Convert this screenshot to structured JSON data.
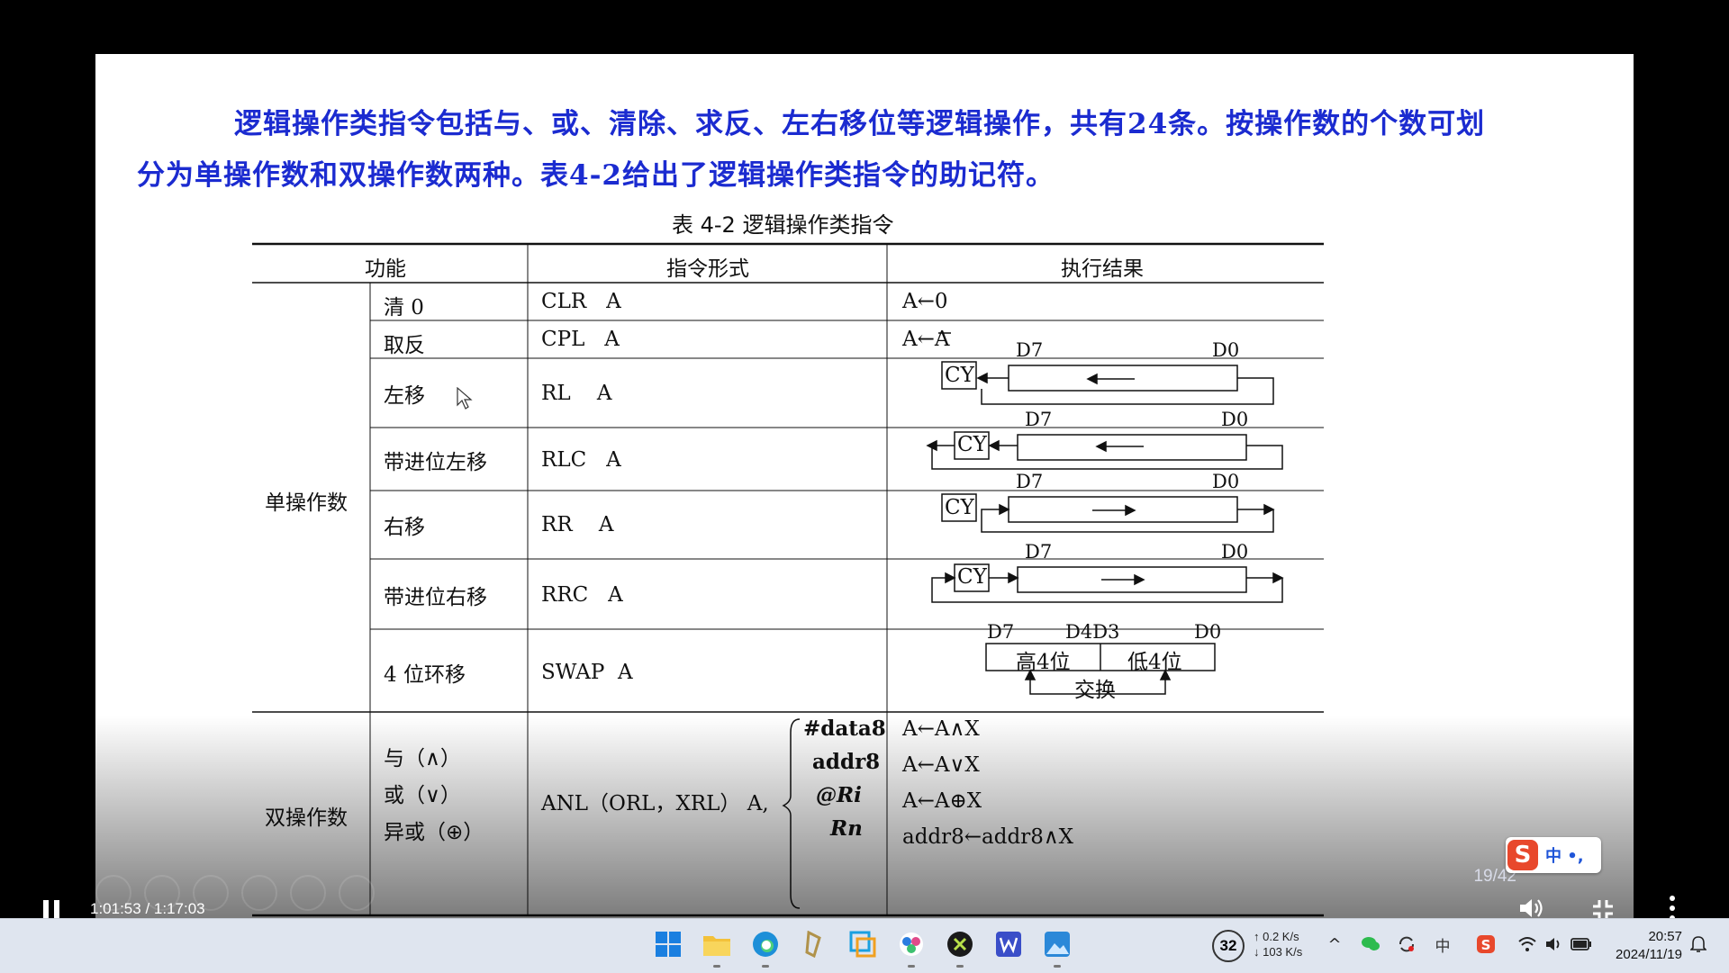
{
  "slide": {
    "intro_line1": "逻辑操作类指令包括与、或、清除、求反、左右移位等逻辑操作，共有24条。按操作数的个数可划",
    "intro_line2": "分为单操作数和双操作数两种。表4-2给出了逻辑操作类指令的助记符。",
    "table_caption": "表 4-2  逻辑操作类指令",
    "headers": [
      "功能",
      "指令形式",
      "执行结果"
    ],
    "group_single": "单操作数",
    "group_double": "双操作数",
    "rows": [
      {
        "func": "清 0",
        "instr": "CLR   A",
        "result": "A←0"
      },
      {
        "func": "取反",
        "instr": "CPL   A",
        "result": "A←",
        "result_bar": "A"
      },
      {
        "func": "左移",
        "instr": "RL    A"
      },
      {
        "func": "带进位左移",
        "instr": "RLC   A"
      },
      {
        "func": "右移",
        "instr": "RR    A"
      },
      {
        "func": "带进位右移",
        "instr": "RRC   A"
      },
      {
        "func": "4 位环移",
        "instr": "SWAP  A"
      }
    ],
    "diagram_labels": {
      "cy": "CY",
      "d7": "D7",
      "d0": "D0",
      "d4d3": "D4D3",
      "high": "高4位",
      "low": "低4位",
      "exchange": "交换"
    },
    "double": {
      "funcs": [
        "与（∧）",
        "或（∨）",
        "异或（⊕）"
      ],
      "instr": "ANL（ORL，XRL） A,",
      "operands": [
        "#data8",
        "addr8",
        "@Ri",
        "Rn"
      ],
      "results": [
        "A←A∧X",
        "A←A∨X",
        "A←A⊕X",
        "addr8←addr8∧X"
      ]
    },
    "page_number": "19/42"
  },
  "ime": {
    "logo": "S",
    "text": "中 •,"
  },
  "player": {
    "time": "1:01:53 / 1:17:03"
  },
  "taskbar": {
    "tray_badge": "32",
    "net_up": "↑ 0.2 K/s",
    "net_down": "↓ 103 K/s",
    "time": "20:57",
    "date": "2024/11/19"
  },
  "colors": {
    "intro_text": "#1b2bd0",
    "taskbar_bg": "#dfe5ef"
  }
}
